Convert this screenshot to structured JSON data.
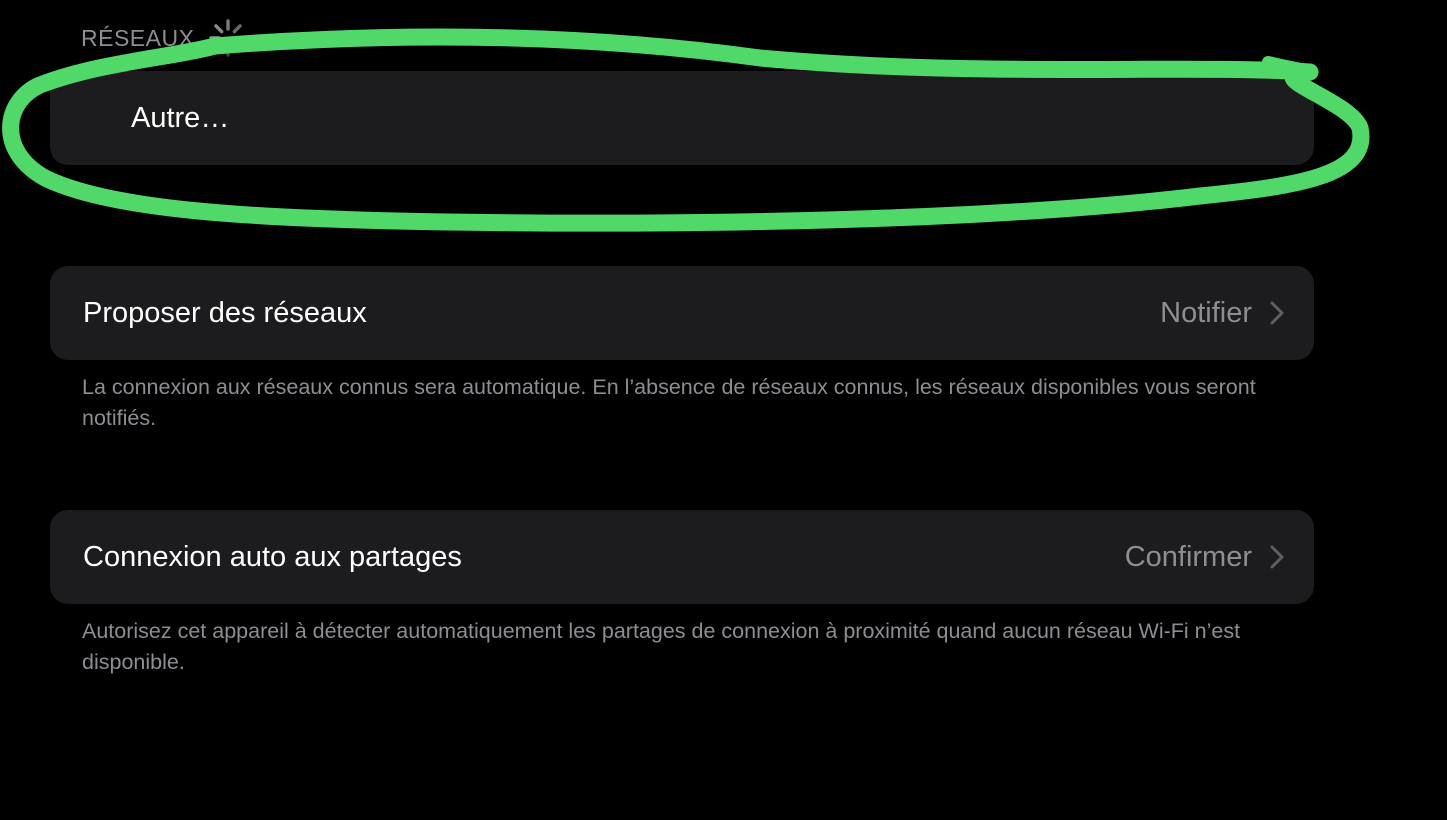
{
  "networks_section": {
    "header": "RÉSEAUX",
    "loading_icon": "activity-spinner-icon",
    "other_label": "Autre…"
  },
  "settings": {
    "ask_to_join": {
      "label": "Proposer des réseaux",
      "value": "Notifier",
      "footnote": "La connexion aux réseaux connus sera automatique. En l’absence de réseaux connus, les réseaux disponibles vous seront notifiés."
    },
    "auto_join_hotspot": {
      "label": "Connexion auto aux partages",
      "value": "Confirmer",
      "footnote": "Autorisez cet appareil à détecter automatiquement les partages de connexion à proximité quand aucun réseau Wi-Fi n’est disponible."
    }
  },
  "colors": {
    "background": "#000000",
    "card": "#1c1c1e",
    "secondary_text": "#8d8d93",
    "highlight_annotation": "#50d868"
  }
}
